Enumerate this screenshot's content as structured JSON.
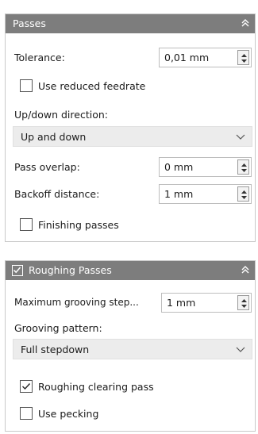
{
  "passes": {
    "title": "Passes",
    "tolerance": {
      "label": "Tolerance:",
      "value": "0,01 mm"
    },
    "use_reduced_feedrate": {
      "label": "Use reduced feedrate",
      "checked": false
    },
    "updown": {
      "label": "Up/down direction:",
      "value": "Up and down"
    },
    "pass_overlap": {
      "label": "Pass overlap:",
      "value": "0 mm"
    },
    "backoff_distance": {
      "label": "Backoff distance:",
      "value": "1 mm"
    },
    "finishing_passes": {
      "label": "Finishing passes",
      "checked": false
    }
  },
  "roughing": {
    "title": "Roughing Passes",
    "enabled": true,
    "max_grooving_step": {
      "label": "Maximum grooving step...",
      "value": "1 mm"
    },
    "grooving_pattern": {
      "label": "Grooving pattern:",
      "value": "Full stepdown"
    },
    "roughing_clearing_pass": {
      "label": "Roughing clearing pass",
      "checked": true
    },
    "use_pecking": {
      "label": "Use pecking",
      "checked": false
    }
  },
  "icons": {
    "collapse": "chevrons-up-icon",
    "spinner": "spinner-arrows-icon",
    "dropdown": "chevron-down-icon",
    "checkmark": "checkmark-icon"
  },
  "colors": {
    "header_bg": "#7d7d7d",
    "dropdown_bg": "#ececec",
    "border": "#c9c9c9"
  }
}
